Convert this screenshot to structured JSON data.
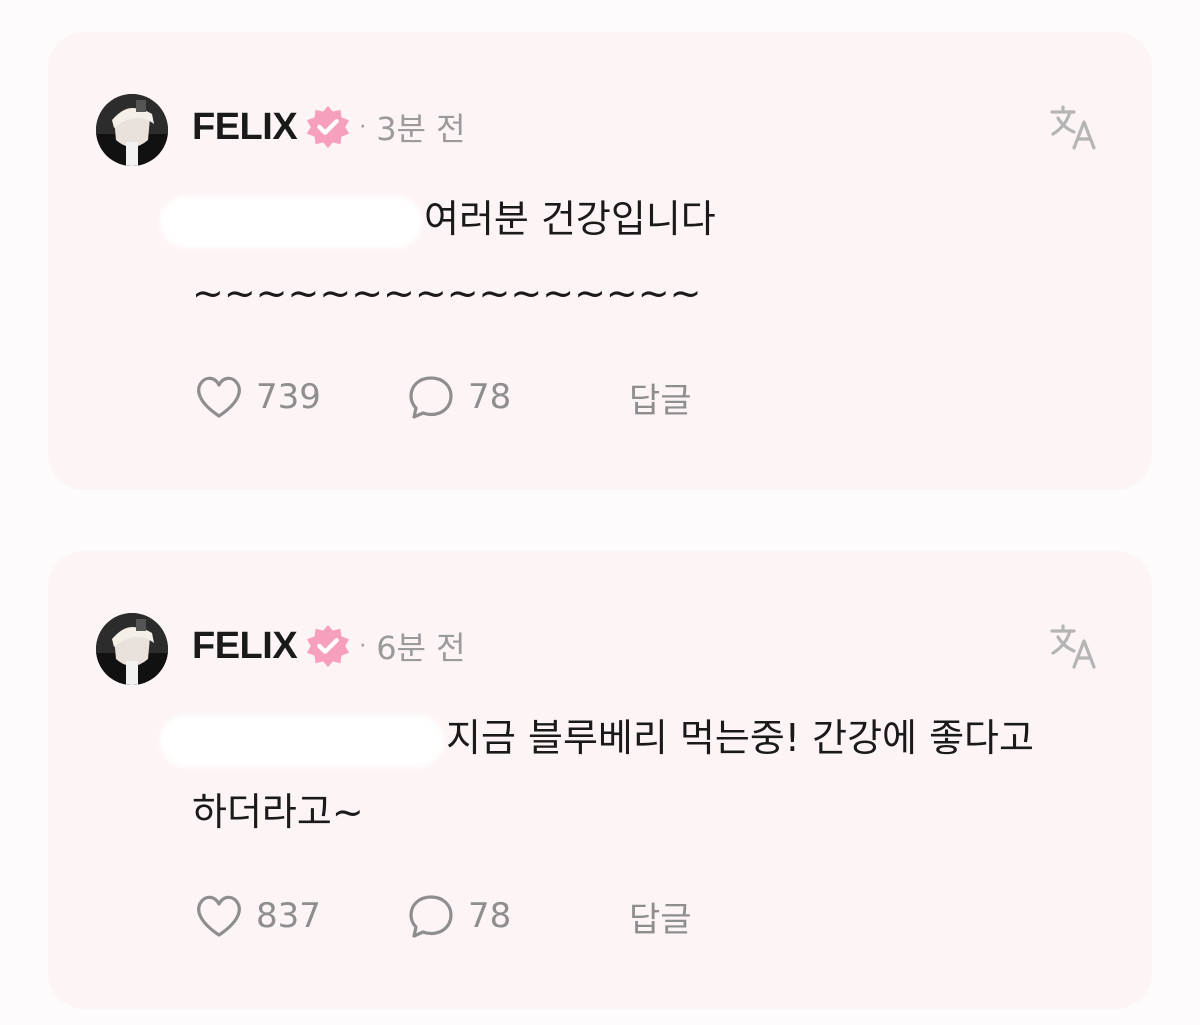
{
  "comments": [
    {
      "author": "FELIX",
      "time": "3분 전",
      "separator": "·",
      "text_line1": "여러분 건강입니다",
      "text_line2": "~~~~~~~~~~~~~~~~",
      "likes": "739",
      "replies": "78",
      "reply_label": "답글"
    },
    {
      "author": "FELIX",
      "time": "6분 전",
      "separator": "·",
      "text_line1": "지금 블루베리 먹는중! 간강에 좋다고",
      "text_line2": "하더라고~",
      "likes": "837",
      "replies": "78",
      "reply_label": "답글"
    }
  ],
  "colors": {
    "card_bg": "#fdf4f5",
    "badge": "#f7a0bd",
    "muted": "#8e8e8e",
    "text": "#1a1a1a"
  },
  "icons": {
    "verified": "verified-badge-icon",
    "translate": "translate-icon",
    "like": "heart-icon",
    "comment": "speech-bubble-icon"
  }
}
